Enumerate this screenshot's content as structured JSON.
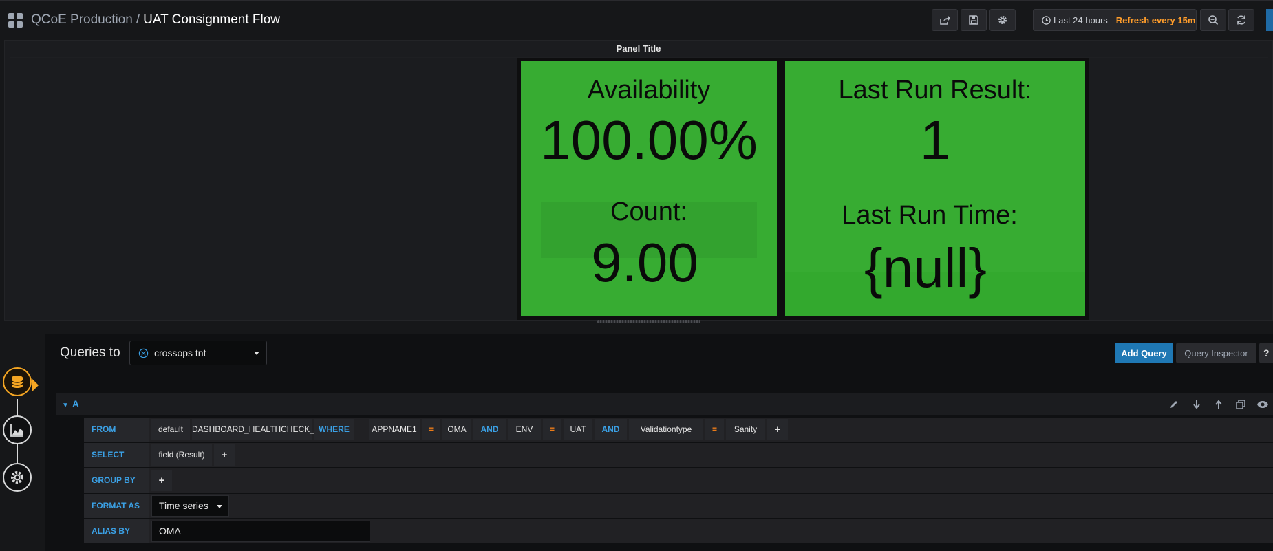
{
  "header": {
    "folder": "QCoE Production",
    "separator": "/",
    "dashboard_title": "UAT Consignment Flow",
    "time_range": "Last 24 hours",
    "refresh": "Refresh every 15m"
  },
  "panel": {
    "title": "Panel Title",
    "stats": [
      {
        "label": "Availability",
        "value": "100.00%"
      },
      {
        "label": "Count:",
        "value": "9.00"
      },
      {
        "label": "Last Run Result:",
        "value": "1"
      },
      {
        "label": "Last Run Time:",
        "value": "{null}"
      }
    ],
    "background_color": "#37ac32"
  },
  "editor": {
    "queries_to_label": "Queries to",
    "datasource": "crossops tnt",
    "add_query_label": "Add Query",
    "query_inspector_label": "Query Inspector",
    "help_label": "?",
    "query_ref": "A",
    "rows": {
      "from": {
        "keyword": "FROM",
        "parts": [
          "default",
          "DASHBOARD_HEALTHCHECK_U",
          "WHERE",
          "APPNAME1",
          "=",
          "OMA",
          "AND",
          "ENV",
          "=",
          "UAT",
          "AND",
          "Validationtype",
          "=",
          "Sanity",
          "+"
        ]
      },
      "select": {
        "keyword": "SELECT",
        "field": "field (Result)",
        "plus": "+"
      },
      "group_by": {
        "keyword": "GROUP BY",
        "plus": "+"
      },
      "format_as": {
        "keyword": "FORMAT AS",
        "value": "Time series"
      },
      "alias_by": {
        "keyword": "ALIAS BY",
        "value": "OMA"
      }
    }
  }
}
